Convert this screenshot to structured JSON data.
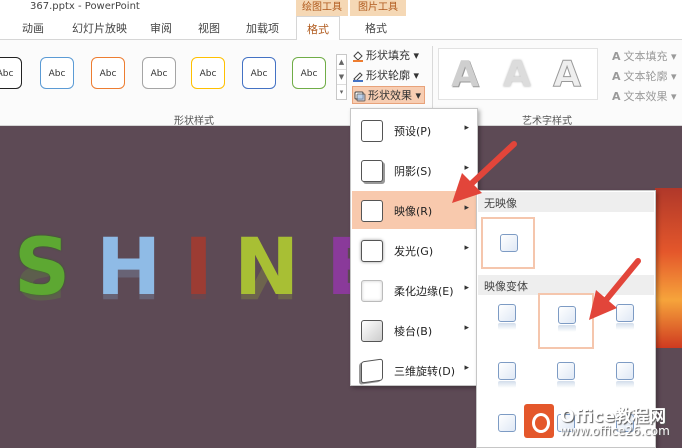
{
  "window": {
    "title": "367.pptx - PowerPoint"
  },
  "contextual_tabs": {
    "drawing_tools": "绘图工具",
    "picture_tools": "图片工具"
  },
  "tabs": [
    "动画",
    "幻灯片放映",
    "审阅",
    "视图",
    "加载项",
    "格式",
    "格式"
  ],
  "ribbon": {
    "shape_styles": {
      "sample_label": "Abc",
      "samples": [
        {
          "border": "#222222"
        },
        {
          "border": "#5b9bd5"
        },
        {
          "border": "#ed7d31"
        },
        {
          "border": "#a5a5a5"
        },
        {
          "border": "#ffc000"
        },
        {
          "border": "#4472c4"
        },
        {
          "border": "#70ad47"
        }
      ],
      "scroll_up": "▲",
      "scroll_down": "▼",
      "scroll_more": "▾",
      "group_label": "形状样式"
    },
    "shape_commands": {
      "fill": "形状填充",
      "outline": "形状轮廓",
      "effects": "形状效果",
      "dropdown": "▾"
    },
    "wordart": {
      "letter": "A",
      "group_label": "艺术字样式",
      "text_fill": "文本填充",
      "text_outline": "文本轮廓",
      "text_effects": "文本效果",
      "icon_letter": "A"
    }
  },
  "slide": {
    "letters": [
      "S",
      "H",
      "I",
      "N",
      "E"
    ]
  },
  "effects_menu": {
    "items": [
      {
        "label": "预设(P)",
        "arrow": "▸",
        "active": false
      },
      {
        "label": "阴影(S)",
        "arrow": "▸",
        "active": false
      },
      {
        "label": "映像(R)",
        "arrow": "▸",
        "active": true
      },
      {
        "label": "发光(G)",
        "arrow": "▸",
        "active": false
      },
      {
        "label": "柔化边缘(E)",
        "arrow": "▸",
        "active": false
      },
      {
        "label": "棱台(B)",
        "arrow": "▸",
        "active": false
      },
      {
        "label": "三维旋转(D)",
        "arrow": "▸",
        "active": false
      }
    ]
  },
  "reflection_menu": {
    "no_reflection_heading": "无映像",
    "variations_heading": "映像变体"
  },
  "watermark": {
    "brand": "Office教程网",
    "url": "www.office26.com"
  },
  "colors": {
    "accent": "#b05a1d",
    "menu_highlight": "#f8c9ad",
    "arrow": "#e2453a",
    "slide_bg": "#5d4a55"
  }
}
